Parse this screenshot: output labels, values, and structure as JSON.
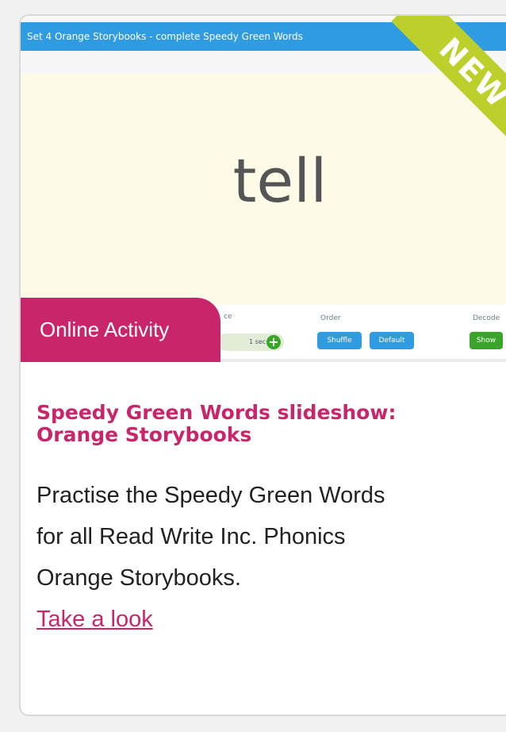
{
  "preview": {
    "topbar_title": "Set 4 Orange Storybooks - complete Speedy Green Words",
    "close_glyph": "×",
    "word": "tell",
    "controls": {
      "speed_label": "ce",
      "speed_value": "1 sec",
      "order_label": "Order",
      "shuffle_label": "Shuffle",
      "default_label": "Default",
      "decode_label": "Decode",
      "show_label": "Show"
    }
  },
  "badge": {
    "text": "NEW",
    "color": "#bccf2a"
  },
  "tab": {
    "label": "Online Activity",
    "color": "#c8256a"
  },
  "card": {
    "title": "Speedy Green Words slideshow: Orange Storybooks",
    "description": "Practise the Speedy Green Words for all Read Write Inc. Phonics Orange Storybooks.",
    "link_text": "Take a look"
  }
}
